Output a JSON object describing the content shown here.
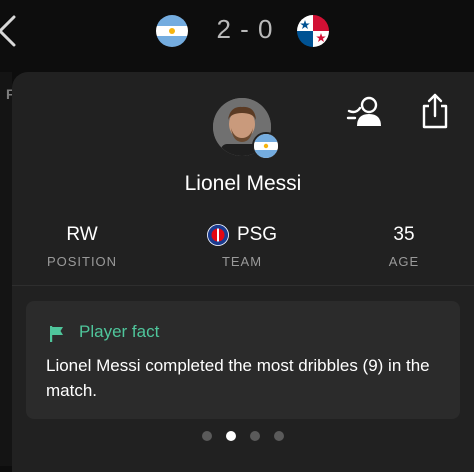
{
  "header": {
    "score": "2 - 0",
    "home_flag_icon": "argentina-flag-icon",
    "away_flag_icon": "panama-flag-icon",
    "back_icon": "chevron-left-icon"
  },
  "background_tab": {
    "peek_letter": "F"
  },
  "player": {
    "name": "Lionel Messi",
    "avatar_icon": "player-avatar",
    "nationality_flag_icon": "argentina-flag-icon"
  },
  "actions": {
    "follow_icon": "follow-player-icon",
    "share_icon": "share-icon"
  },
  "stats": [
    {
      "value": "RW",
      "label": "POSITION"
    },
    {
      "value": "PSG",
      "label": "TEAM",
      "icon": "psg-crest-icon"
    },
    {
      "value": "35",
      "label": "AGE"
    }
  ],
  "fact": {
    "title": "Player fact",
    "text": "Lionel Messi completed the most dribbles (9) in the match.",
    "icon": "flag-icon",
    "accent_color": "#4fc59b"
  },
  "pagination": {
    "count": 4,
    "active_index": 1
  },
  "colors": {
    "background": "#0d0d0d",
    "sheet": "#212121",
    "card": "#2b2b2b",
    "accent": "#4fc59b",
    "muted_text": "#9a9a9a"
  }
}
